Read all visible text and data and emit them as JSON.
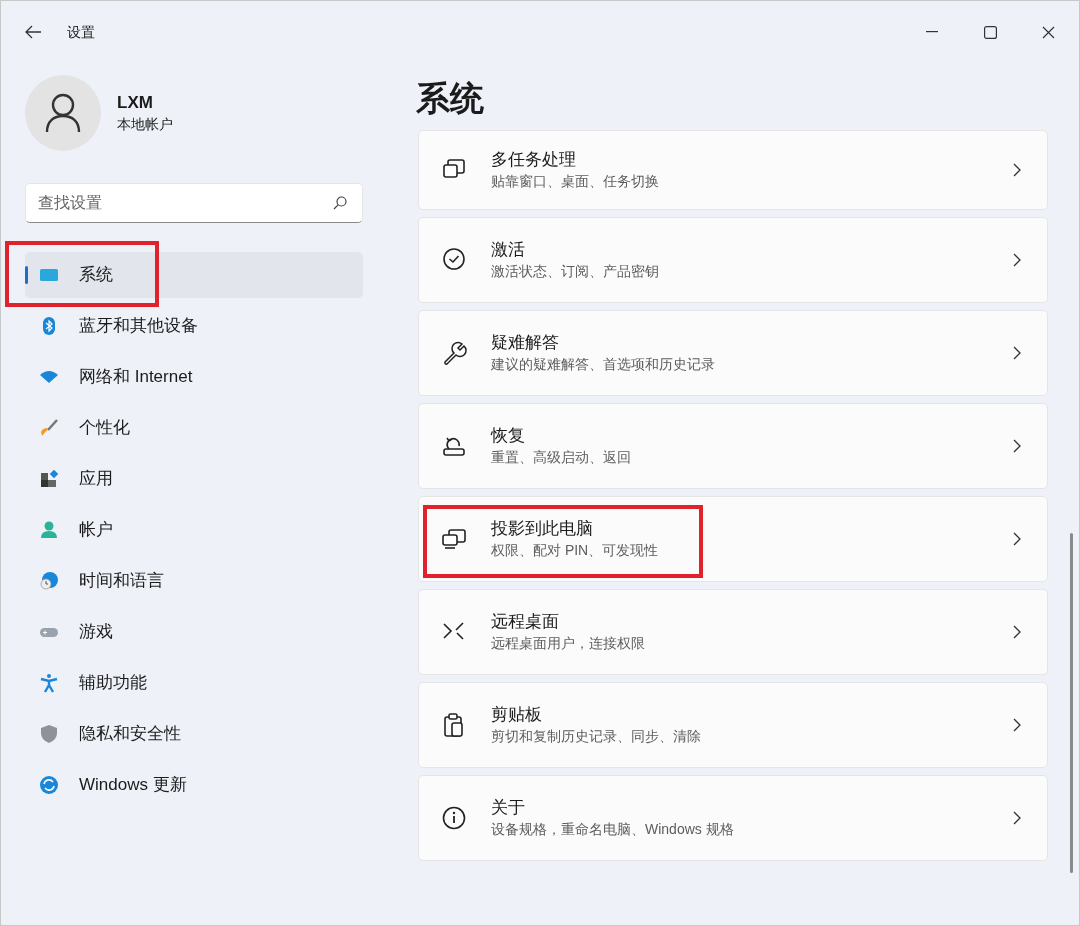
{
  "window": {
    "title": "设置"
  },
  "account": {
    "name": "LXM",
    "type": "本地帐户"
  },
  "search": {
    "placeholder": "查找设置"
  },
  "sidebar": {
    "items": [
      {
        "label": "系统",
        "selected": true,
        "annotated": true
      },
      {
        "label": "蓝牙和其他设备",
        "selected": false,
        "annotated": false
      },
      {
        "label": "网络和 Internet",
        "selected": false,
        "annotated": false
      },
      {
        "label": "个性化",
        "selected": false,
        "annotated": false
      },
      {
        "label": "应用",
        "selected": false,
        "annotated": false
      },
      {
        "label": "帐户",
        "selected": false,
        "annotated": false
      },
      {
        "label": "时间和语言",
        "selected": false,
        "annotated": false
      },
      {
        "label": "游戏",
        "selected": false,
        "annotated": false
      },
      {
        "label": "辅助功能",
        "selected": false,
        "annotated": false
      },
      {
        "label": "隐私和安全性",
        "selected": false,
        "annotated": false
      },
      {
        "label": "Windows 更新",
        "selected": false,
        "annotated": false
      }
    ]
  },
  "page": {
    "title": "系统"
  },
  "settings": [
    {
      "title": "多任务处理",
      "subtitle": "贴靠窗口、桌面、任务切换",
      "annotated": false
    },
    {
      "title": "激活",
      "subtitle": "激活状态、订阅、产品密钥",
      "annotated": false
    },
    {
      "title": "疑难解答",
      "subtitle": "建议的疑难解答、首选项和历史记录",
      "annotated": false
    },
    {
      "title": "恢复",
      "subtitle": "重置、高级启动、返回",
      "annotated": false
    },
    {
      "title": "投影到此电脑",
      "subtitle": "权限、配对 PIN、可发现性",
      "annotated": true
    },
    {
      "title": "远程桌面",
      "subtitle": "远程桌面用户，连接权限",
      "annotated": false
    },
    {
      "title": "剪贴板",
      "subtitle": "剪切和复制历史记录、同步、清除",
      "annotated": false
    },
    {
      "title": "关于",
      "subtitle": "设备规格，重命名电脑、Windows 规格",
      "annotated": false
    }
  ]
}
